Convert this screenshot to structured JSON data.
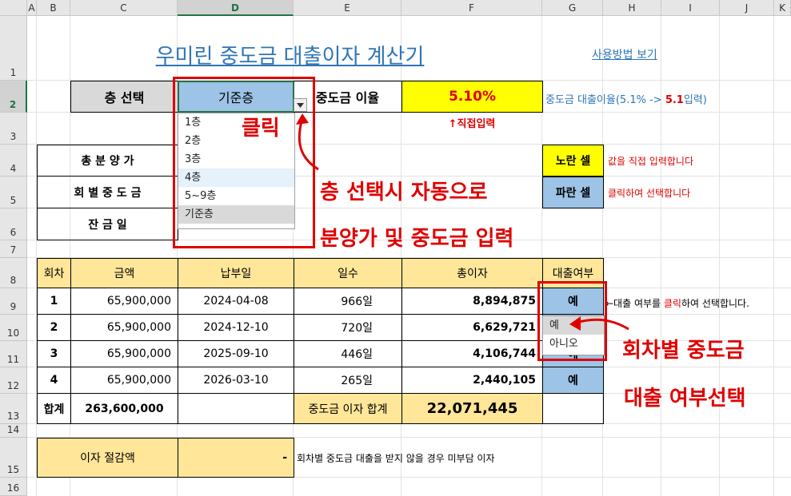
{
  "columns": [
    "A",
    "B",
    "C",
    "D",
    "E",
    "F",
    "G",
    "H",
    "I",
    "J",
    "K"
  ],
  "rows": [
    "1",
    "2",
    "3",
    "4",
    "5",
    "6",
    "7",
    "8",
    "9",
    "10",
    "11",
    "12",
    "13",
    "14",
    "15",
    "16"
  ],
  "title": "우미린 중도금 대출이자 계산기",
  "how_to_link": "사용방법 보기",
  "floor_label": "층 선택",
  "floor_value": "기준층",
  "rate_label": "중도금 이율",
  "rate_value": "5.10%",
  "rate_note_prefix": "중도금 대출이율(5.1%  -> ",
  "rate_note_bold": "5.1",
  "rate_note_suffix": "입력)",
  "direct_input_note": "↑직접입력",
  "info_labels": [
    "총 분 양 가",
    "회 별 중 도 금",
    "잔 금 일"
  ],
  "legend_yellow": "노란 셀",
  "legend_yellow_note": "값을 직접 입력합니다",
  "legend_blue": "파란 셀",
  "legend_blue_note": "클릭하여 선택합니다",
  "floor_options": [
    "1층",
    "2층",
    "3층",
    "4층",
    "5~9층",
    "기준층"
  ],
  "table_headers": [
    "회차",
    "금액",
    "납부일",
    "일수",
    "총이자",
    "대출여부"
  ],
  "table_rows": [
    {
      "no": "1",
      "amount": "65,900,000",
      "date": "2024-04-08",
      "days": "966일",
      "interest": "8,894,875",
      "loan": "예"
    },
    {
      "no": "2",
      "amount": "65,900,000",
      "date": "2024-12-10",
      "days": "720일",
      "interest": "6,629,721",
      "loan": "예"
    },
    {
      "no": "3",
      "amount": "65,900,000",
      "date": "2025-09-10",
      "days": "446일",
      "interest": "4,106,744",
      "loan": "예"
    },
    {
      "no": "4",
      "amount": "65,900,000",
      "date": "2026-03-10",
      "days": "265일",
      "interest": "2,440,105",
      "loan": "예"
    }
  ],
  "total_label": "합계",
  "total_amount": "263,600,000",
  "interest_total_label": "중도금 이자 합계",
  "interest_total_value": "22,071,445",
  "savings_label": "이자 절감액",
  "savings_value": "-",
  "savings_note": "회차별 중도금 대출을 받지 않을 경우 미부담 이자",
  "loan_note_prefix": "←대출 여부를 ",
  "loan_note_red": "클릭",
  "loan_note_suffix": "하여 선택합니다.",
  "loan_options": [
    "예",
    "아니오"
  ],
  "annotations": {
    "click": "클릭",
    "floor_auto_1": "층 선택시 자동으로",
    "floor_auto_2": "분양가 및 중도금 입력",
    "loan_select_1": "회차별 중도금",
    "loan_select_2": "대출 여부선택"
  },
  "colors": {
    "blue_cell": "#9dc3e6",
    "yellow_cell": "#ffff00",
    "peach_cell": "#ffe699",
    "gray_cell": "#d9d9d9",
    "annotation_red": "#e00000",
    "link_blue": "#2e75b6"
  }
}
